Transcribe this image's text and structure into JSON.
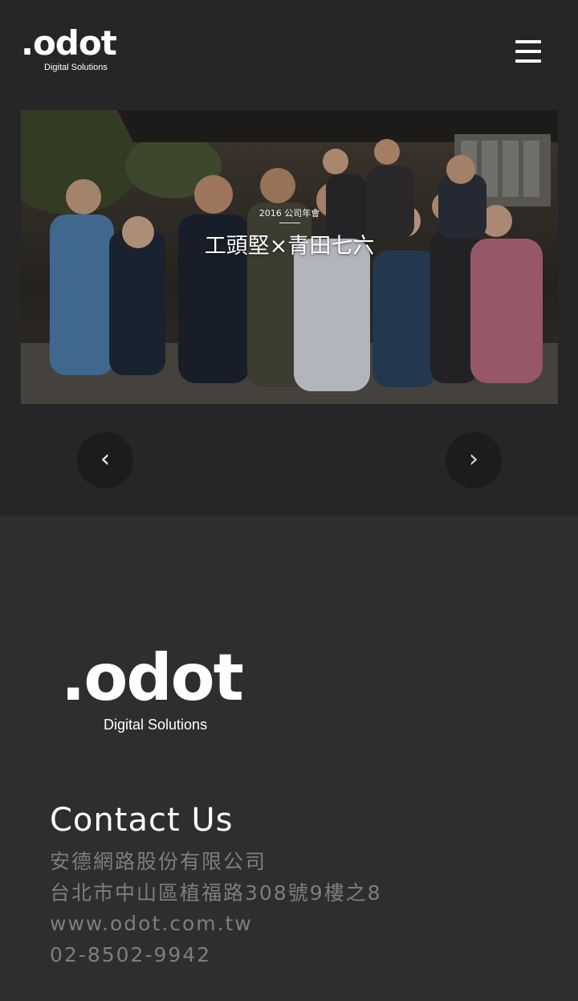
{
  "header": {
    "logo_word": ".odot",
    "logo_sub": "Digital Solutions",
    "menu_icon": "hamburger-menu-icon"
  },
  "slider": {
    "subtitle": "2016 公司年會",
    "title": "工頭堅×青田七六",
    "prev_label": "‹",
    "next_label": "›"
  },
  "footer": {
    "logo_word": ".odot",
    "logo_sub": "Digital Solutions",
    "heading": "Contact Us",
    "company": "安德網路股份有限公司",
    "address": "台北市中山區植福路308號9樓之8",
    "website": "www.odot.com.tw",
    "phone": "02-8502-9942"
  },
  "colors": {
    "top_bg": "#262626",
    "footer_bg": "#2e2e2e",
    "contact_text": "#7e7e7e",
    "arrow_bg": "#1c1c1c"
  }
}
